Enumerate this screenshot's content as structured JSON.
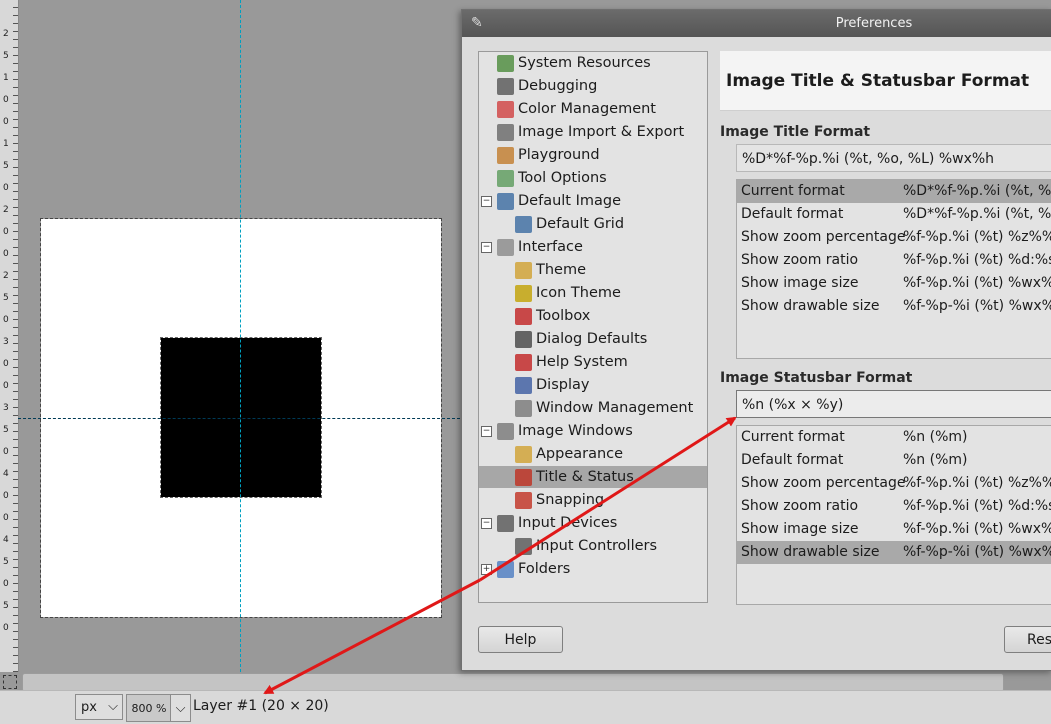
{
  "dialog": {
    "title": "Preferences",
    "heading": "Image Title & Statusbar Format",
    "title_section_label": "Image Title Format",
    "title_format_value": "%D*%f-%p.%i (%t, %o, %L) %wx%h",
    "title_formats": [
      {
        "name": "Current format",
        "value": "%D*%f-%p.%i (%t, %o, %"
      },
      {
        "name": "Default format",
        "value": "%D*%f-%p.%i (%t, %o, %"
      },
      {
        "name": "Show zoom percentage",
        "value": "%f-%p.%i (%t) %z%%"
      },
      {
        "name": "Show zoom ratio",
        "value": "%f-%p.%i (%t) %d:%s"
      },
      {
        "name": "Show image size",
        "value": "%f-%p.%i (%t) %wx%h"
      },
      {
        "name": "Show drawable size",
        "value": "%f-%p-%i (%t) %wx%h ("
      }
    ],
    "statusbar_section_label": "Image Statusbar Format",
    "statusbar_format_value": "%n (%x × %y)",
    "statusbar_formats": [
      {
        "name": "Current format",
        "value": "%n (%m)"
      },
      {
        "name": "Default format",
        "value": "%n (%m)"
      },
      {
        "name": "Show zoom percentage",
        "value": "%f-%p.%i (%t) %z%%"
      },
      {
        "name": "Show zoom ratio",
        "value": "%f-%p.%i (%t) %d:%s"
      },
      {
        "name": "Show image size",
        "value": "%f-%p.%i (%t) %wx%h"
      },
      {
        "name": "Show drawable size",
        "value": "%f-%p-%i (%t) %wx%h ("
      }
    ],
    "help_button": "Help",
    "reset_button": "Res"
  },
  "tree": [
    {
      "label": "System Resources",
      "icon": "chip-icon"
    },
    {
      "label": "Debugging",
      "icon": "wilber-icon"
    },
    {
      "label": "Color Management",
      "icon": "color-wheel-icon"
    },
    {
      "label": "Image Import & Export",
      "icon": "import-export-icon"
    },
    {
      "label": "Playground",
      "icon": "rocking-horse-icon"
    },
    {
      "label": "Tool Options",
      "icon": "tool-options-icon"
    },
    {
      "label": "Default Image",
      "icon": "image-icon"
    },
    {
      "label": "Default Grid",
      "icon": "grid-icon"
    },
    {
      "label": "Interface",
      "icon": "interface-icon"
    },
    {
      "label": "Theme",
      "icon": "theme-icon"
    },
    {
      "label": "Icon Theme",
      "icon": "icon-theme-icon"
    },
    {
      "label": "Toolbox",
      "icon": "toolbox-icon"
    },
    {
      "label": "Dialog Defaults",
      "icon": "dialog-defaults-icon"
    },
    {
      "label": "Help System",
      "icon": "lifebuoy-icon"
    },
    {
      "label": "Display",
      "icon": "display-icon"
    },
    {
      "label": "Window Management",
      "icon": "window-icon"
    },
    {
      "label": "Image Windows",
      "icon": "image-windows-icon"
    },
    {
      "label": "Appearance",
      "icon": "appearance-icon"
    },
    {
      "label": "Title & Status",
      "icon": "title-status-icon"
    },
    {
      "label": "Snapping",
      "icon": "magnet-icon"
    },
    {
      "label": "Input Devices",
      "icon": "joystick-icon"
    },
    {
      "label": "Input Controllers",
      "icon": "controller-icon"
    },
    {
      "label": "Folders",
      "icon": "folder-icon"
    }
  ],
  "statusbar": {
    "unit": "px",
    "zoom": "800 %",
    "layer_text": "Layer #1 (20 × 20)"
  },
  "ruler_labels": [
    "2",
    "5",
    "1",
    "0",
    "0",
    "1",
    "5",
    "0",
    "2",
    "0",
    "0",
    "2",
    "5",
    "0",
    "3",
    "0",
    "0",
    "3",
    "5",
    "0",
    "4",
    "0",
    "0",
    "4",
    "5",
    "0",
    "5",
    "0"
  ],
  "colors": {
    "annotation_arrow": "#e01818",
    "guide": "#00a0c0",
    "selection": "#a9a9a9"
  }
}
